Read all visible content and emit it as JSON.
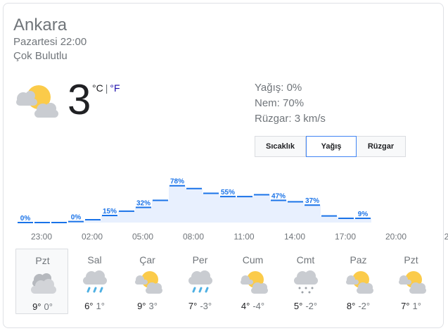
{
  "location": "Ankara",
  "datetime": "Pazartesi 22:00",
  "condition": "Çok Bulutlu",
  "current": {
    "temp": "3",
    "unit_c": "°C",
    "sep": "|",
    "unit_f": "°F",
    "icon": "partly-cloudy-icon"
  },
  "stats": {
    "precip": "Yağış: 0%",
    "humidity": "Nem: 70%",
    "wind": "Rüzgar: 3 km/s"
  },
  "tabs": [
    "Sıcaklık",
    "Yağış",
    "Rüzgar"
  ],
  "active_tab": "Yağış",
  "colors": {
    "accent": "#1a73e8",
    "fill": "#e8f0fe",
    "sun": "#fbcb4a",
    "cloud": "#c9ccd1",
    "rain": "#4fb0e3"
  },
  "chart_data": {
    "type": "area",
    "series": [
      {
        "name": "Yağış",
        "values": [
          0,
          0,
          0,
          2,
          6,
          15,
          24,
          32,
          47,
          78,
          72,
          62,
          55,
          55,
          59,
          47,
          44,
          37,
          14,
          9,
          9
        ]
      }
    ],
    "labels": [
      "0%",
      "",
      "",
      "0%",
      "",
      "15%",
      "",
      "32%",
      "",
      "78%",
      "",
      "",
      "55%",
      "",
      "",
      "47%",
      "",
      "37%",
      "",
      "",
      "9%"
    ],
    "x_ticks": [
      "23:00",
      "02:00",
      "05:00",
      "08:00",
      "11:00",
      "14:00",
      "17:00",
      "20:00",
      "2"
    ],
    "ylim": [
      0,
      100
    ]
  },
  "forecast": [
    {
      "day": "Pzt",
      "hi": "9°",
      "lo": "0°",
      "icon": "cloudy-icon"
    },
    {
      "day": "Sal",
      "hi": "6°",
      "lo": "1°",
      "icon": "rain-icon"
    },
    {
      "day": "Çar",
      "hi": "9°",
      "lo": "3°",
      "icon": "partly-cloudy-icon"
    },
    {
      "day": "Per",
      "hi": "7°",
      "lo": "-3°",
      "icon": "rain-icon"
    },
    {
      "day": "Cum",
      "hi": "4°",
      "lo": "-4°",
      "icon": "partly-cloudy-icon"
    },
    {
      "day": "Cmt",
      "hi": "5°",
      "lo": "-2°",
      "icon": "snow-icon"
    },
    {
      "day": "Paz",
      "hi": "8°",
      "lo": "-2°",
      "icon": "partly-cloudy-icon"
    },
    {
      "day": "Pzt",
      "hi": "7°",
      "lo": "1°",
      "icon": "partly-cloudy-icon"
    }
  ]
}
